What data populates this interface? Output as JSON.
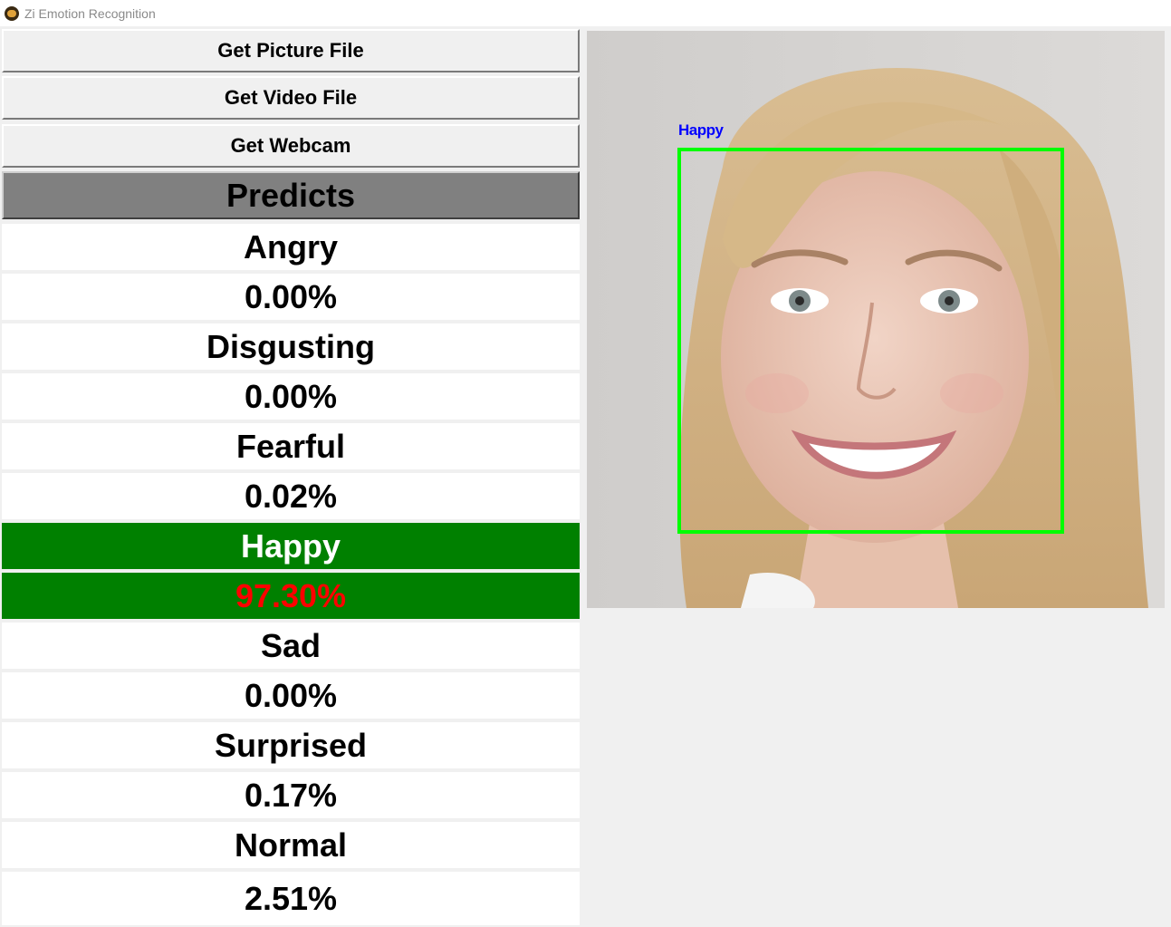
{
  "window": {
    "title": "Zi Emotion Recognition",
    "icon": "app-logo-icon"
  },
  "controls": {
    "picture_button": "Get Picture File",
    "video_button": "Get Video File",
    "webcam_button": "Get Webcam"
  },
  "predicts": {
    "header": "Predicts",
    "rows": [
      {
        "label": "Angry",
        "value": "0.00%"
      },
      {
        "label": "Disgusting",
        "value": "0.00%"
      },
      {
        "label": "Fearful",
        "value": "0.02%"
      },
      {
        "label": "Happy",
        "value": "97.30%"
      },
      {
        "label": "Sad",
        "value": "0.00%"
      },
      {
        "label": "Surprised",
        "value": "0.17%"
      },
      {
        "label": "Normal",
        "value": "2.51%"
      }
    ],
    "highlight_index": 3,
    "colors": {
      "highlight_bg": "#008000",
      "highlight_label": "#ffffff",
      "highlight_value": "#ff0000"
    }
  },
  "preview": {
    "detection_label": "Happy",
    "box_color": "#00ff00",
    "label_color": "#0000ff"
  }
}
